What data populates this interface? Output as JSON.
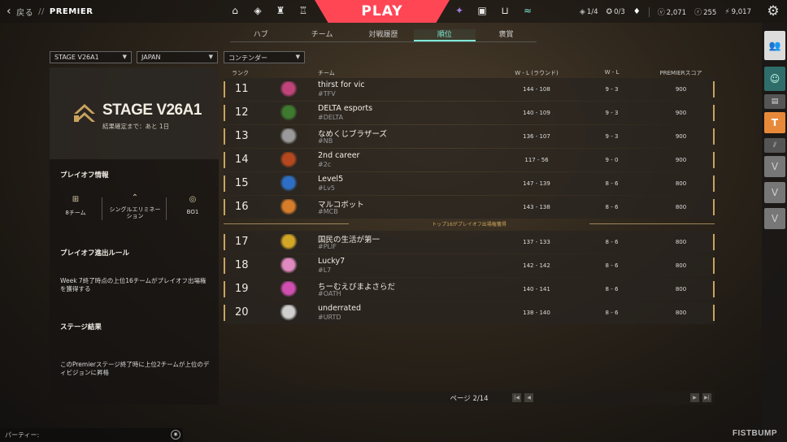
{
  "topbar": {
    "back_label": "戻る",
    "separator": "//",
    "section": "PREMIER",
    "play_label": "PLAY",
    "left_icons": [
      "home-icon",
      "career-icon",
      "agents-icon",
      "collection-icon"
    ],
    "right_icons": [
      "battlepass-icon",
      "store-icon",
      "cart-icon",
      "premier-icon"
    ],
    "currencies": [
      {
        "icon": "◈",
        "name": "kingdom-credits",
        "value": "1/4"
      },
      {
        "icon": "✪",
        "name": "daily-tickets",
        "value": "0/3"
      },
      {
        "icon": "♦",
        "name": "radianite-card",
        "value": ""
      },
      {
        "icon": "ⓥ",
        "name": "valorant-points",
        "value": "2,071"
      },
      {
        "icon": "ⓡ",
        "name": "radianite",
        "value": "255"
      },
      {
        "icon": "⚡",
        "name": "kingdom-points",
        "value": "9,017"
      }
    ]
  },
  "tabs": [
    {
      "label": "ハブ",
      "active": false
    },
    {
      "label": "チーム",
      "active": false
    },
    {
      "label": "対戦履歴",
      "active": false
    },
    {
      "label": "順位",
      "active": true
    },
    {
      "label": "褒賞",
      "active": false
    }
  ],
  "filters": {
    "stage": "STAGE V26A1",
    "region": "JAPAN",
    "division": "コンテンダー"
  },
  "left": {
    "stage_title": "STAGE V26A1",
    "stage_sub": "結果確定まで：あと 1日",
    "playoff_title": "プレイオフ情報",
    "playoff_items": [
      {
        "icon": "bracket-icon",
        "label": "8チーム"
      },
      {
        "icon": "single-elim-icon",
        "label": "シングルエリミネーション"
      },
      {
        "icon": "bo1-icon",
        "label": "BO1"
      }
    ],
    "rule_title": "プレイオフ進出ルール",
    "rule_text": "Week 7終了時点の上位16チームがプレイオフ出場権を獲得する",
    "result_title": "ステージ結果",
    "result_text": "このPremierステージ終了時に上位2チームが上位のディビジョンに昇格"
  },
  "table": {
    "headers": {
      "rank": "ランク",
      "team": "チーム",
      "wl_rounds": "W - L (ラウンド)",
      "wl": "W - L",
      "score": "PREMIERスコア"
    },
    "cutline": "トップ16がプレイオフ出場権獲得",
    "rows": [
      {
        "rank": "11",
        "name": "thirst for vic",
        "tag": "#TFV",
        "wlr": "144 - 108",
        "wl": "9 - 3",
        "score": "900",
        "color": "#c0447a"
      },
      {
        "rank": "12",
        "name": "DELTA  esports",
        "tag": "#DELTA",
        "wlr": "140 - 109",
        "wl": "9 - 3",
        "score": "900",
        "color": "#3e7a2f"
      },
      {
        "rank": "13",
        "name": "なめくじブラザーズ",
        "tag": "#NB",
        "wlr": "136 - 107",
        "wl": "9 - 3",
        "score": "900",
        "color": "#9a9a9a"
      },
      {
        "rank": "14",
        "name": "2nd career",
        "tag": "#2c",
        "wlr": "117 - 56",
        "wl": "9 - 0",
        "score": "900",
        "color": "#b5481e"
      },
      {
        "rank": "15",
        "name": "Level5",
        "tag": "#Lv5",
        "wlr": "147 - 139",
        "wl": "8 - 6",
        "score": "800",
        "color": "#2d6fc4"
      },
      {
        "rank": "16",
        "name": "マルコボット",
        "tag": "#MCB",
        "wlr": "143 - 138",
        "wl": "8 - 6",
        "score": "800",
        "color": "#d67d2a"
      },
      {
        "rank": "17",
        "name": "国民の生活が第一",
        "tag": "#PLIF",
        "wlr": "137 - 133",
        "wl": "8 - 6",
        "score": "800",
        "color": "#d4a626"
      },
      {
        "rank": "18",
        "name": "Lucky7",
        "tag": "#L7",
        "wlr": "142 - 142",
        "wl": "8 - 6",
        "score": "800",
        "color": "#e08ac0"
      },
      {
        "rank": "19",
        "name": "ちーむえびまよさらだ",
        "tag": "#OATH",
        "wlr": "140 - 141",
        "wl": "8 - 6",
        "score": "800",
        "color": "#d04fb0"
      },
      {
        "rank": "20",
        "name": "underrated",
        "tag": "#URTD",
        "wlr": "138 - 140",
        "wl": "8 - 6",
        "score": "800",
        "color": "#cfcfcf"
      }
    ]
  },
  "pager": {
    "info": "ページ 2/14"
  },
  "bottom": {
    "party_label": "パーティー:",
    "brand": "FISTBUMP"
  }
}
